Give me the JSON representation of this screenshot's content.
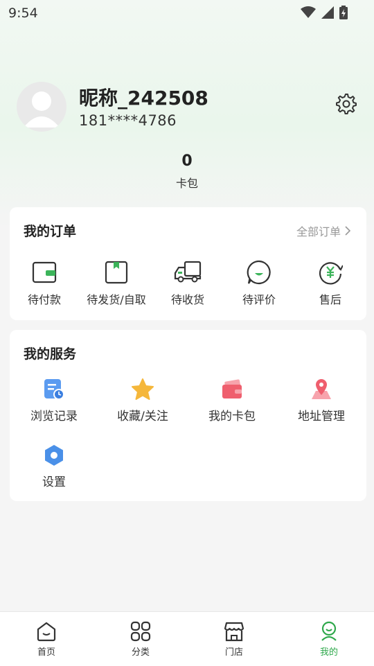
{
  "status_bar": {
    "time": "9:54"
  },
  "profile": {
    "nickname": "昵称_242508",
    "phone": "181****4786"
  },
  "card_count": {
    "value": "0",
    "label": "卡包"
  },
  "orders": {
    "title": "我的订单",
    "all_label": "全部订单",
    "items": [
      {
        "label": "待付款",
        "icon": "wallet-icon"
      },
      {
        "label": "待发货/自取",
        "icon": "bookmark-box-icon"
      },
      {
        "label": "待收货",
        "icon": "truck-icon"
      },
      {
        "label": "待评价",
        "icon": "comment-icon"
      },
      {
        "label": "售后",
        "icon": "yuan-refresh-icon"
      }
    ]
  },
  "services": {
    "title": "我的服务",
    "items": [
      {
        "label": "浏览记录",
        "icon": "history-icon"
      },
      {
        "label": "收藏/关注",
        "icon": "star-icon"
      },
      {
        "label": "我的卡包",
        "icon": "card-wallet-icon"
      },
      {
        "label": "地址管理",
        "icon": "location-icon"
      },
      {
        "label": "设置",
        "icon": "settings-hex-icon"
      }
    ]
  },
  "bottom_nav": {
    "items": [
      {
        "label": "首页",
        "icon": "home-icon"
      },
      {
        "label": "分类",
        "icon": "category-icon"
      },
      {
        "label": "门店",
        "icon": "store-icon"
      },
      {
        "label": "我的",
        "icon": "profile-icon"
      }
    ],
    "active_index": 3
  },
  "colors": {
    "accent": "#2ea84b",
    "background": "#f5f5f5"
  }
}
